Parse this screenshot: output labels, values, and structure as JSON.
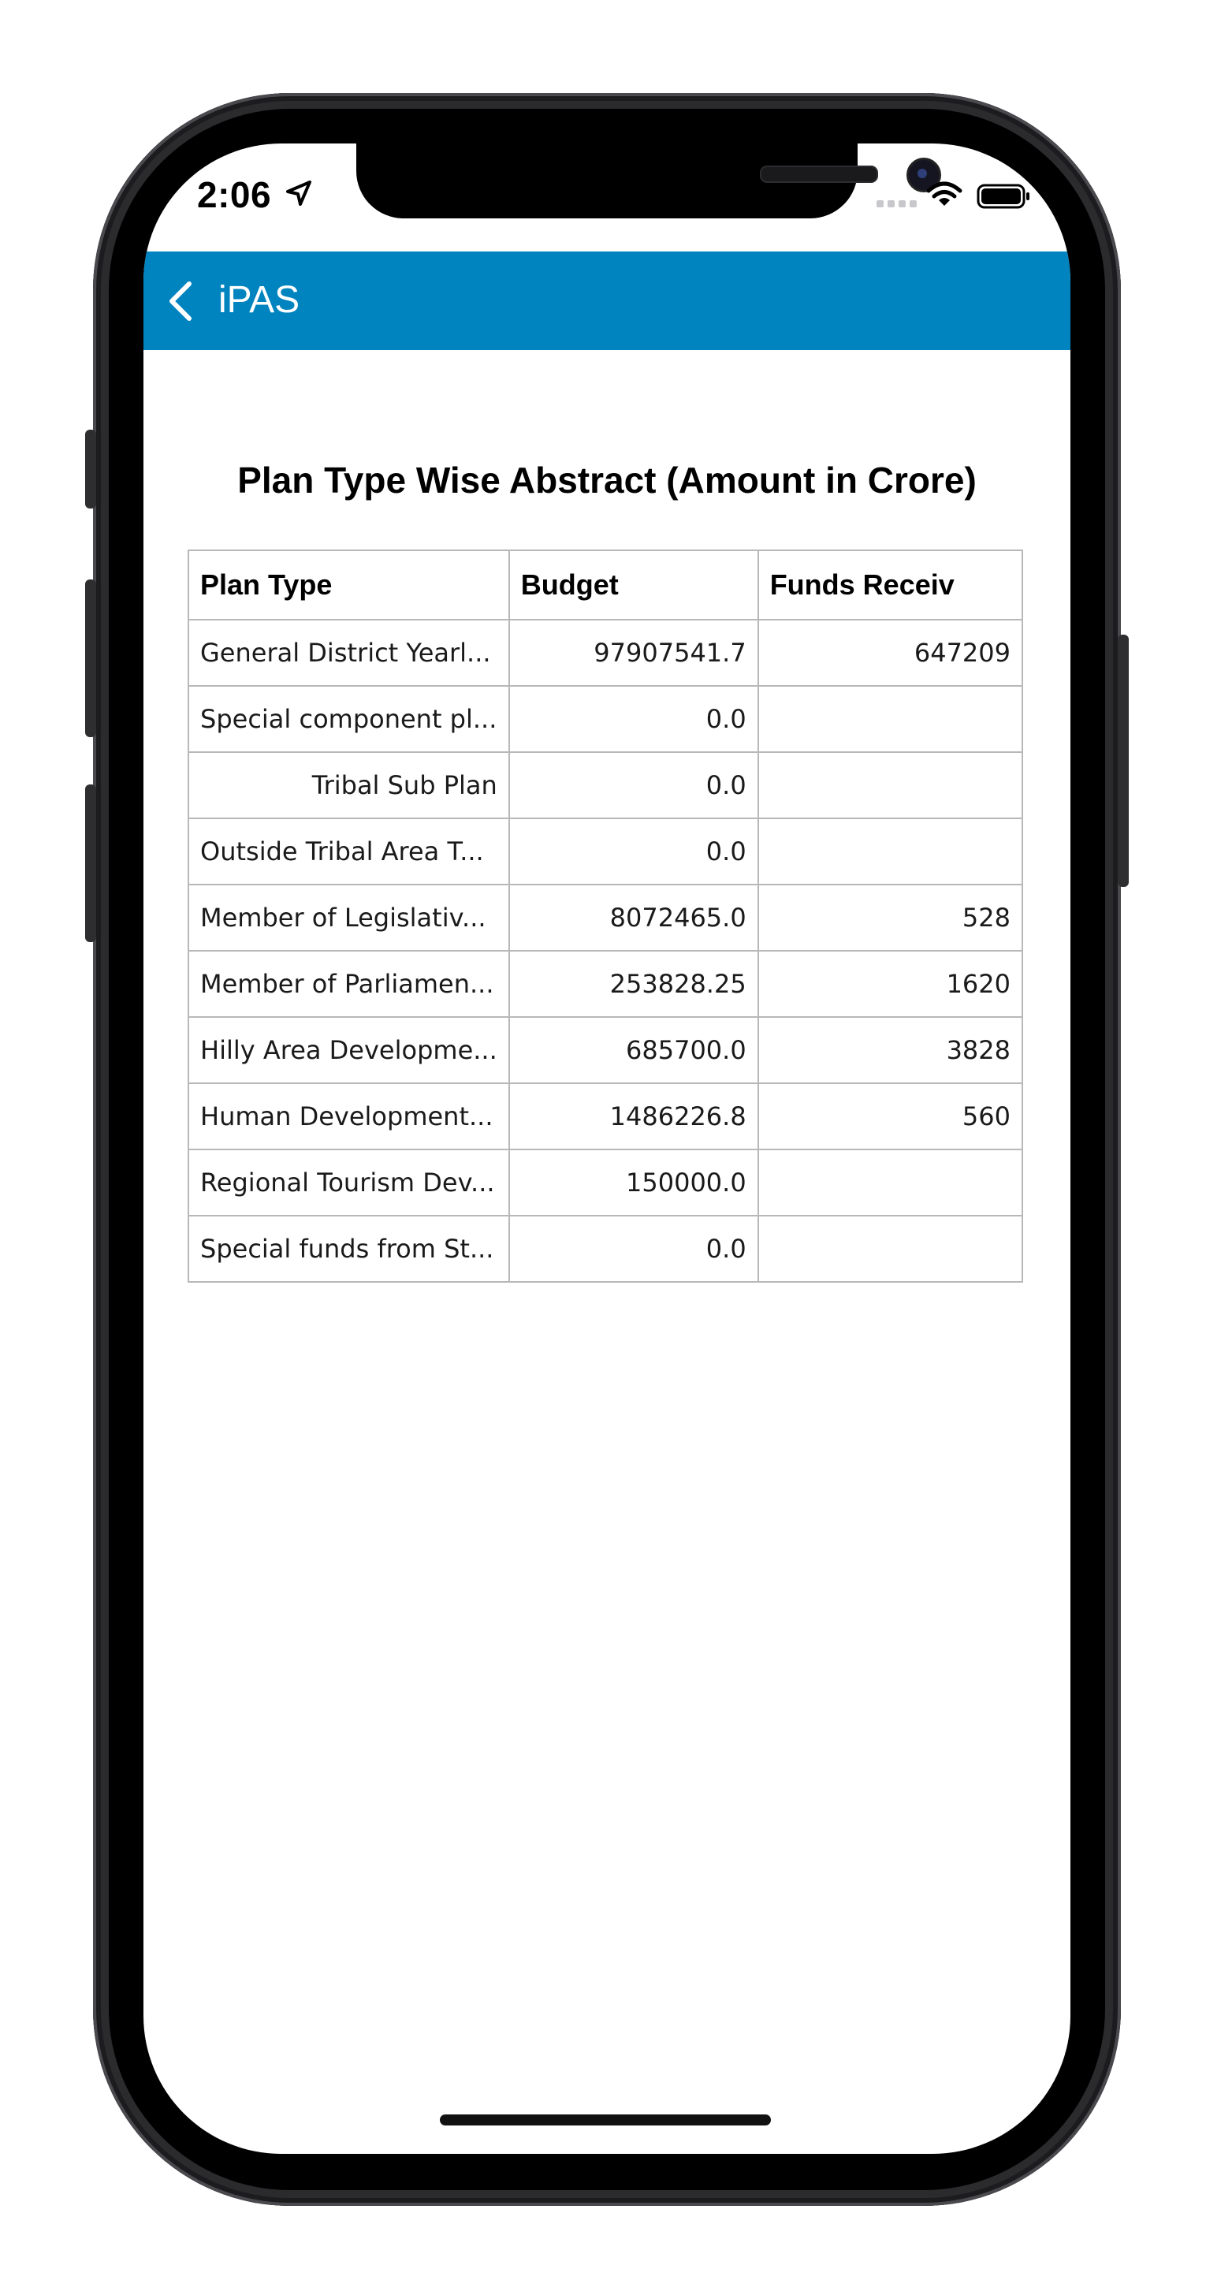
{
  "status_bar": {
    "time": "2:06",
    "icons": [
      "location-arrow-icon",
      "signal-icon",
      "wifi-icon",
      "battery-icon"
    ]
  },
  "navbar": {
    "back_label": "iPAS",
    "background": "#0084bf"
  },
  "title": "Plan Type Wise Abstract (Amount in Crore)",
  "table": {
    "headers": [
      "Plan Type",
      "Budget",
      "Funds Receiv"
    ],
    "rows": [
      {
        "plan": "General District Yearl...",
        "budget": "97907541.7",
        "funds": "647209"
      },
      {
        "plan": "Special component pl...",
        "budget": "0.0",
        "funds": ""
      },
      {
        "plan": "Tribal Sub Plan",
        "budget": "0.0",
        "funds": ""
      },
      {
        "plan": "Outside Tribal Area T...",
        "budget": "0.0",
        "funds": ""
      },
      {
        "plan": "Member of Legislativ...",
        "budget": "8072465.0",
        "funds": "528"
      },
      {
        "plan": "Member of Parliamen...",
        "budget": "253828.25",
        "funds": "1620"
      },
      {
        "plan": "Hilly Area Developme...",
        "budget": "685700.0",
        "funds": "3828"
      },
      {
        "plan": "Human Development...",
        "budget": "1486226.8",
        "funds": "560"
      },
      {
        "plan": "Regional Tourism Dev...",
        "budget": "150000.0",
        "funds": ""
      },
      {
        "plan": "Special funds from St...",
        "budget": "0.0",
        "funds": ""
      }
    ]
  }
}
